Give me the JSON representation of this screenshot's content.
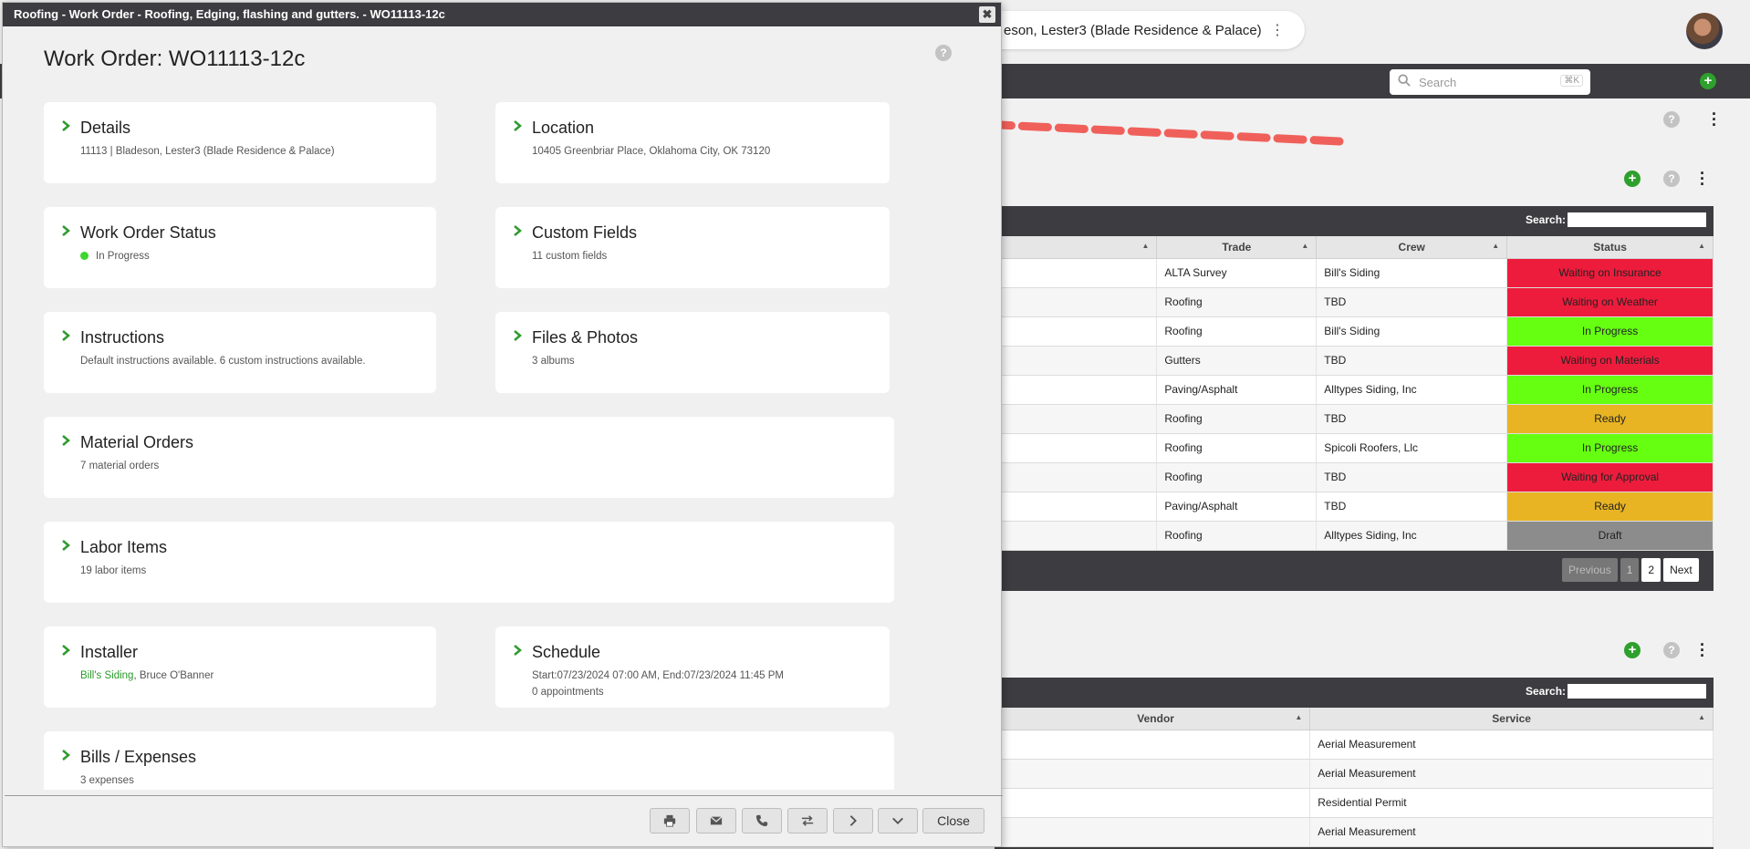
{
  "background": {
    "context_pill": "eson, Lester3 (Blade Residence & Palace)",
    "search": {
      "placeholder": "Search",
      "shortcut": "⌘K"
    },
    "grid1": {
      "search_label": "Search:",
      "columns": [
        "Trade",
        "Crew",
        "Status"
      ],
      "rows": [
        {
          "trade": "ALTA Survey",
          "crew": "Bill's Siding",
          "status": "Waiting on Insurance",
          "color": "#ee1c3c"
        },
        {
          "trade": "Roofing",
          "crew": "TBD",
          "status": "Waiting on Weather",
          "color": "#ee1c3c"
        },
        {
          "trade": "Roofing",
          "crew": "Bill's Siding",
          "status": "In Progress",
          "color": "#66ff11"
        },
        {
          "trade": "Gutters",
          "crew": "TBD",
          "status": "Waiting on Materials",
          "color": "#ee1c3c"
        },
        {
          "trade": "Paving/Asphalt",
          "crew": "Alltypes Siding, Inc",
          "status": "In Progress",
          "color": "#66ff11"
        },
        {
          "trade": "Roofing",
          "crew": "TBD",
          "status": "Ready",
          "color": "#e8b423"
        },
        {
          "trade": "Roofing",
          "crew": "Spicoli Roofers, Llc",
          "status": "In Progress",
          "color": "#66ff11"
        },
        {
          "trade": "Roofing",
          "crew": "TBD",
          "status": "Waiting for Approval",
          "color": "#ee1c3c"
        },
        {
          "trade": "Paving/Asphalt",
          "crew": "TBD",
          "status": "Ready",
          "color": "#e8b423"
        },
        {
          "trade": "Roofing",
          "crew": "Alltypes Siding, Inc",
          "status": "Draft",
          "color": "#8c8c8c"
        }
      ],
      "pager": {
        "previous": "Previous",
        "page1": "1",
        "page2": "2",
        "next": "Next"
      }
    },
    "grid2": {
      "search_label": "Search:",
      "columns": [
        "Vendor",
        "Service"
      ],
      "rows": [
        {
          "vendor": "",
          "service": "Aerial Measurement"
        },
        {
          "vendor": "",
          "service": "Aerial Measurement"
        },
        {
          "vendor": "",
          "service": "Residential Permit"
        },
        {
          "vendor": "",
          "service": "Aerial Measurement"
        }
      ]
    }
  },
  "modal": {
    "window_title": "Roofing - Work Order - Roofing, Edging, flashing and gutters. - WO11113-12c",
    "close_x": "✖",
    "title": "Work Order: WO11113-12c",
    "help": "?",
    "cards": {
      "details": {
        "title": "Details",
        "sub": "11113 | Bladeson, Lester3 (Blade Residence & Palace)"
      },
      "location": {
        "title": "Location",
        "sub": "10405 Greenbriar Place, Oklahoma City, OK 73120"
      },
      "status": {
        "title": "Work Order Status",
        "sub": "In Progress"
      },
      "custom": {
        "title": "Custom Fields",
        "sub": "11 custom fields"
      },
      "instructions": {
        "title": "Instructions",
        "sub": "Default instructions available. 6 custom instructions available."
      },
      "files": {
        "title": "Files & Photos",
        "sub": "3 albums"
      },
      "materials": {
        "title": "Material Orders",
        "sub": "7 material orders"
      },
      "labor": {
        "title": "Labor Items",
        "sub": "19 labor items"
      },
      "installer": {
        "title": "Installer",
        "crew": "Bill's Siding",
        "person": ", Bruce O'Banner"
      },
      "schedule": {
        "title": "Schedule",
        "sub": "Start:07/23/2024 07:00 AM, End:07/23/2024 11:45 PM",
        "sub2": "0 appointments"
      },
      "bills": {
        "title": "Bills / Expenses",
        "sub": "3 expenses"
      }
    },
    "footer": {
      "close": "Close"
    }
  },
  "colors": {
    "accent_green": "#2ea02e",
    "arrow": "#f0605a",
    "dark_bar": "#3d3c40"
  }
}
